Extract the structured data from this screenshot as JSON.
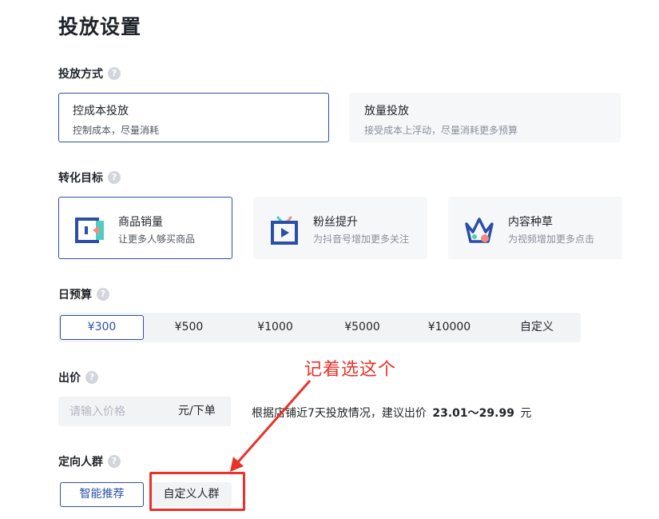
{
  "page_title": "投放设置",
  "delivery_method": {
    "label": "投放方式",
    "options": [
      {
        "title": "控成本投放",
        "desc": "控制成本，尽量消耗",
        "selected": true
      },
      {
        "title": "放量投放",
        "desc": "接受成本上浮动，尽量消耗更多预算",
        "selected": false
      }
    ]
  },
  "conversion_goal": {
    "label": "转化目标",
    "options": [
      {
        "title": "商品销量",
        "desc": "让更多人够买商品",
        "icon": "product-sales-icon",
        "selected": true
      },
      {
        "title": "粉丝提升",
        "desc": "为抖音号增加更多关注",
        "icon": "tv-play-icon",
        "selected": false
      },
      {
        "title": "内容种草",
        "desc": "为视频增加更多点击",
        "icon": "crown-icon",
        "selected": false
      }
    ]
  },
  "daily_budget": {
    "label": "日预算",
    "options": [
      "¥300",
      "¥500",
      "¥1000",
      "¥5000",
      "¥10000",
      "自定义"
    ],
    "selected_index": 0
  },
  "bid": {
    "label": "出价",
    "placeholder": "请输入价格",
    "value": "",
    "unit": "元/下单",
    "suggest_prefix": "根据店铺近7天投放情况，建议出价",
    "suggest_range": "23.01〜29.99",
    "suggest_suffix": "元"
  },
  "targeting": {
    "label": "定向人群",
    "options": [
      "智能推荐",
      "自定义人群"
    ],
    "selected_index": 0
  },
  "annotation": {
    "text": "记着选这个"
  },
  "colors": {
    "accent": "#2b4fa8",
    "annotation": "#e8322a",
    "option_bg": "#f2f3f5"
  }
}
